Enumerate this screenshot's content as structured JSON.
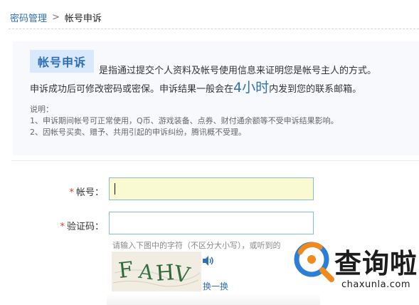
{
  "breadcrumb": {
    "parent": "密码管理",
    "separator": ">",
    "current": "帐号申诉"
  },
  "intro": {
    "badge": "帐号申诉",
    "line1": "是指通过提交个人资料及帐号使用信息来证明您是帐号主人的方式。",
    "line2_before": "申诉成功后可修改密码或密保。申诉结果一般会在",
    "line2_highlight": "4小时",
    "line2_after": "内发到您的联系邮箱。"
  },
  "notes": {
    "heading": "说明：",
    "items": [
      "1、申诉期间帐号可正常使用，Q币、游戏装备、点券、财付通余额等不受申诉结果影响。",
      "2、因帐号买卖、赠予、共用引起的申诉纠纷，腾讯概不受理。"
    ]
  },
  "form": {
    "required_mark": "*",
    "account_label": "帐号：",
    "account_value": "",
    "captcha_label": "验证码：",
    "captcha_value": "",
    "hint": "请输入下图中的字符（不区分大小写），或听到的",
    "captcha_image_text": "FAHV",
    "refresh_link": "换一换"
  },
  "watermark": {
    "title": "查询啦",
    "site": "chaxunla.com"
  },
  "colors": {
    "link": "#2f6fb5",
    "badge_bg": "#d9e9fb",
    "required": "#e23a2a",
    "focused_input_bg": "#fafad2",
    "input_border": "#88b7e0",
    "watermark_orange": "#f08a1c",
    "watermark_blue": "#2b7fd6"
  }
}
